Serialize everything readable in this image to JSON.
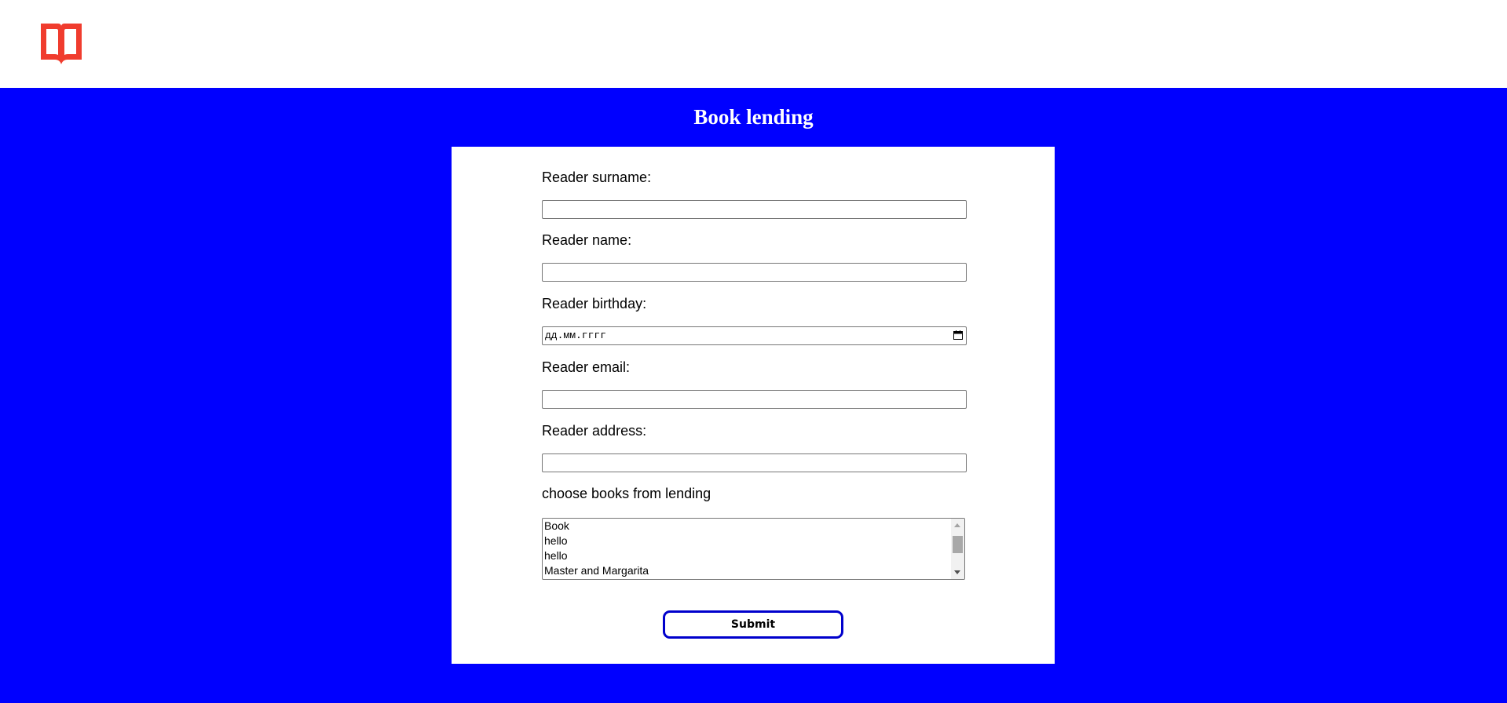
{
  "page": {
    "title": "Book lending"
  },
  "logo": {
    "icon": "open-book-icon",
    "color": "#f03c2e"
  },
  "form": {
    "surname_label": "Reader surname:",
    "surname_value": "",
    "name_label": "Reader name:",
    "name_value": "",
    "birthday_label": "Reader birthday:",
    "birthday_placeholder": "дд.мм.гггг",
    "email_label": "Reader email:",
    "email_value": "",
    "address_label": "Reader address:",
    "address_value": "",
    "books_label": "choose books from lending",
    "books": [
      "Book",
      "hello",
      "hello",
      "Master and Margarita"
    ],
    "submit_label": "Submit"
  },
  "colors": {
    "background": "#0000ff",
    "panel": "#ffffff",
    "button_border": "#0000cc"
  }
}
